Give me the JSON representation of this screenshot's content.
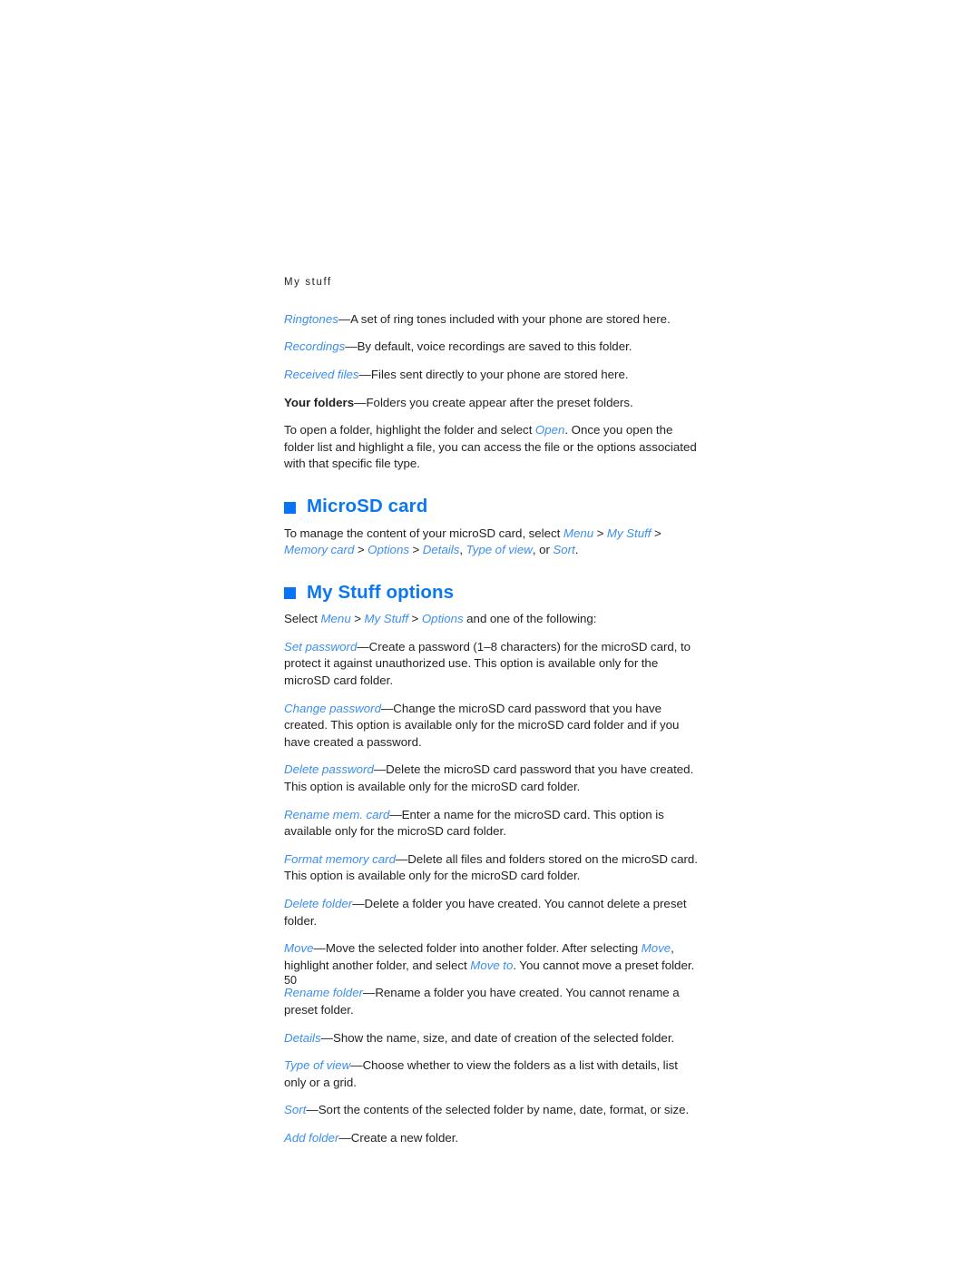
{
  "document": {
    "running_header": "My stuff",
    "page_number": "50",
    "colors": {
      "heading_blue": "#0b78f2",
      "bullet_blue": "#0a72f5",
      "inline_ref_blue": "#3b8fef",
      "body_text": "#231f20",
      "background": "#ffffff"
    }
  },
  "paragraphs": {
    "ringtones": {
      "term": "Ringtones",
      "text": "—A set of ring tones included with your phone are stored here."
    },
    "recordings": {
      "term": "Recordings",
      "text": "—By default, voice recordings are saved to this folder."
    },
    "received_files": {
      "term": "Received files",
      "text": "—Files sent directly to your phone are stored here."
    },
    "your_folders": {
      "term": "Your folders",
      "text": "—Folders you create appear after the preset folders."
    },
    "open_folder": {
      "part1": "To open a folder, highlight the folder and select ",
      "ref_open": "Open",
      "part2": ". Once you open the folder list and highlight a file, you can access the file or the options associated with that specific file type."
    }
  },
  "sections": {
    "microsd": {
      "heading": "MicroSD card",
      "intro": {
        "part1": "To manage the content of your microSD card, select ",
        "ref_menu": "Menu",
        "sep1": " > ",
        "ref_mystuff": "My Stuff",
        "sep2": " > ",
        "ref_memorycard": "Memory card",
        "sep3": " > ",
        "ref_options": "Options",
        "sep4": " > ",
        "ref_details": "Details",
        "sep5": ", ",
        "ref_typeofview": "Type of view",
        "sep6": ", or ",
        "ref_sort": "Sort",
        "end": "."
      }
    },
    "my_stuff_options": {
      "heading": "My Stuff options",
      "intro": {
        "part1": "Select ",
        "ref_menu": "Menu",
        "sep1": " > ",
        "ref_mystuff": "My Stuff",
        "sep2": " > ",
        "ref_options": "Options",
        "part2": " and one of the following:"
      },
      "options": [
        {
          "term": "Set password",
          "text": "—Create a password (1–8 characters) for the microSD card, to protect it against unauthorized use. This option is available only for the microSD card folder."
        },
        {
          "term": "Change password",
          "text": "—Change the microSD card password that you have created. This option is available only for the microSD card folder and if you have created a password."
        },
        {
          "term": "Delete password",
          "text": "—Delete the microSD card password that you have created. This option is available only for the microSD card folder."
        },
        {
          "term": "Rename mem. card",
          "text": "—Enter a name for the microSD card. This option is available only for the microSD card folder."
        },
        {
          "term": "Format memory card",
          "text": "—Delete all files and folders stored on the microSD card. This option is available only for the microSD card folder."
        },
        {
          "term": "Delete folder",
          "text": "—Delete a folder you have created. You cannot delete a preset folder."
        },
        {
          "term": "Rename folder",
          "text": "—Rename a folder you have created. You cannot rename a preset folder."
        },
        {
          "term": "Details",
          "text": "—Show the name, size, and date of creation of the selected folder."
        },
        {
          "term": "Type of view",
          "text": "—Choose whether to view the folders as a list with details, list only or a grid."
        },
        {
          "term": "Sort",
          "text": "—Sort the contents of the selected folder by name, date, format, or size."
        },
        {
          "term": "Add folder",
          "text": "—Create a new folder."
        }
      ],
      "move_option": {
        "term": "Move",
        "part1": "—Move the selected folder into another folder. After selecting ",
        "ref_move": "Move",
        "part2": ", highlight another folder, and select ",
        "ref_moveto": "Move to",
        "part3": ". You cannot move a preset folder."
      }
    }
  }
}
